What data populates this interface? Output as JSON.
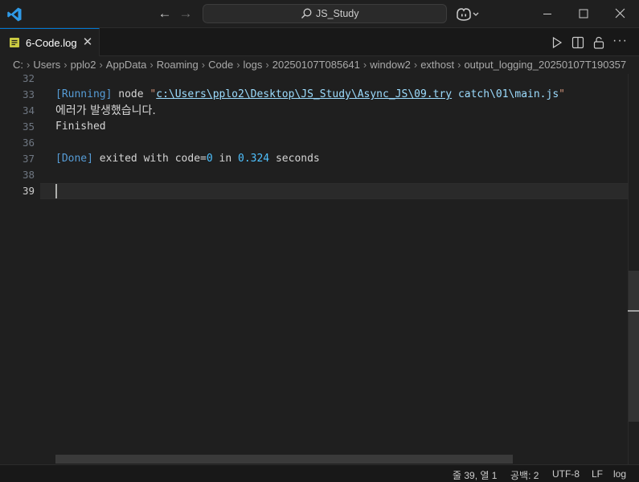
{
  "titlebar": {
    "search_label": "JS_Study",
    "icons": [
      "vscode-logo-icon",
      "back-arrow-icon",
      "forward-arrow-icon",
      "search-icon",
      "copilot-icon",
      "chevron-down-icon",
      "minimize-icon",
      "maximize-icon",
      "close-icon"
    ]
  },
  "tabs": [
    {
      "label": "6-Code.log",
      "icon": "log-file-icon",
      "active": true
    }
  ],
  "editor_actions": [
    "run-icon",
    "split-editor-icon",
    "lock-icon",
    "more-actions-icon"
  ],
  "breadcrumb": [
    "C:",
    "Users",
    "pplo2",
    "AppData",
    "Roaming",
    "Code",
    "logs",
    "20250107T085641",
    "window2",
    "exthost",
    "output_logging_20250107T190357"
  ],
  "editor": {
    "line_numbers": [
      "32",
      "33",
      "34",
      "35",
      "36",
      "37",
      "38",
      "39"
    ],
    "active_line": "39",
    "lines": {
      "l33": {
        "bracket_open": "[",
        "running": "Running",
        "bracket_close": "]",
        "node": " node ",
        "quote_open": "\"",
        "path_part1": "c:\\Users\\pplo2\\Desktop\\JS_Study\\Async_JS\\09.try",
        "space": " ",
        "path_part2": "catch\\01\\main.js",
        "quote_close": "\""
      },
      "l34": "에러가 발생했습니다.",
      "l35": "Finished",
      "l37": {
        "bracket_open": "[",
        "done": "Done",
        "bracket_close": "]",
        "text1": " exited with code=",
        "code": "0",
        "text2": " in ",
        "seconds": "0.324",
        "text3": " seconds"
      }
    }
  },
  "statusbar": {
    "position": "줄 39, 열 1",
    "indent": "공백: 2",
    "encoding": "UTF-8",
    "eol": "LF",
    "language": "log"
  },
  "colors": {
    "accent": "#0078d4",
    "background": "#1f1f1f",
    "keyword_blue": "#569cd6",
    "path_lightblue": "#9cdcfe",
    "number_blue": "#4fc1ff",
    "log_icon_yellow": "#cbcb41"
  }
}
